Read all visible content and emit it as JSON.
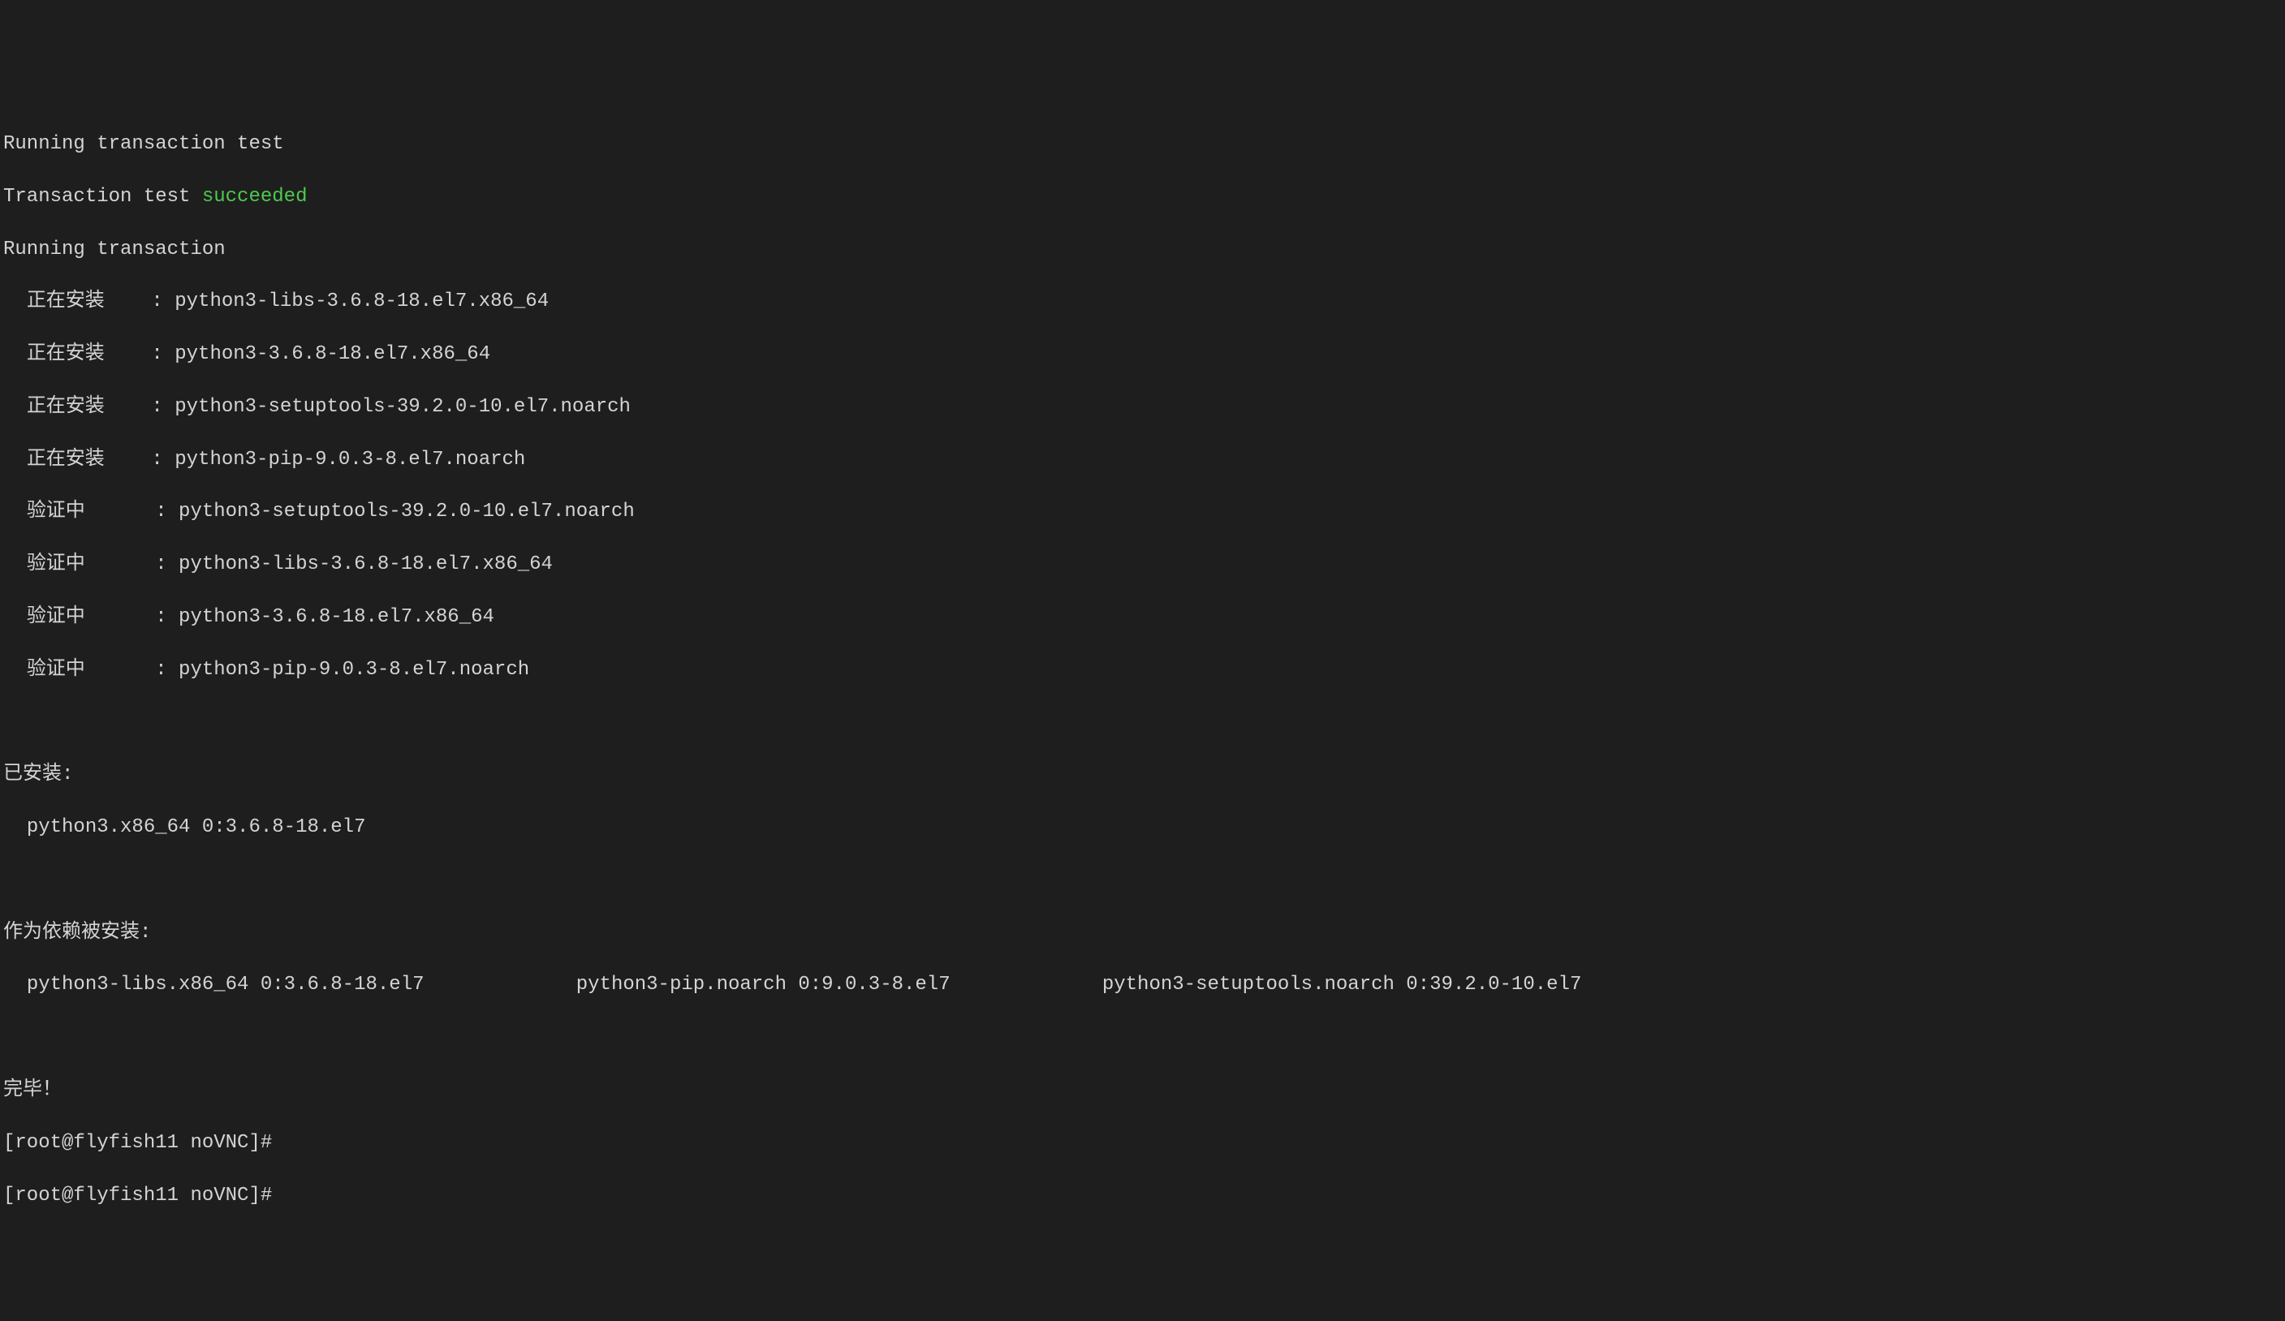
{
  "lines": {
    "l0": "Running transaction test",
    "l1a": "Transaction test ",
    "l1b": "succeeded",
    "l2": "Running transaction",
    "install_label": "正在安装",
    "verify_label": "验证中",
    "colon": ": ",
    "pkg1": "python3-libs-3.6.8-18.el7.x86_64",
    "pkg2": "python3-3.6.8-18.el7.x86_64",
    "pkg3": "python3-setuptools-39.2.0-10.el7.noarch",
    "pkg4": "python3-pip-9.0.3-8.el7.noarch",
    "pkg5": "python3-setuptools-39.2.0-10.el7.noarch",
    "pkg6": "python3-libs-3.6.8-18.el7.x86_64",
    "pkg7": "python3-3.6.8-18.el7.x86_64",
    "pkg8": "python3-pip-9.0.3-8.el7.noarch",
    "installed_header": "已安装:",
    "installed_pkg": "python3.x86_64 0:3.6.8-18.el7",
    "dep_header": "作为依赖被安装:",
    "dep1": "python3-libs.x86_64 0:3.6.8-18.el7",
    "dep2": "python3-pip.noarch 0:9.0.3-8.el7",
    "dep3": "python3-setuptools.noarch 0:39.2.0-10.el7",
    "complete": "完毕！",
    "prompt": "[root@flyfish11 noVNC]#"
  }
}
